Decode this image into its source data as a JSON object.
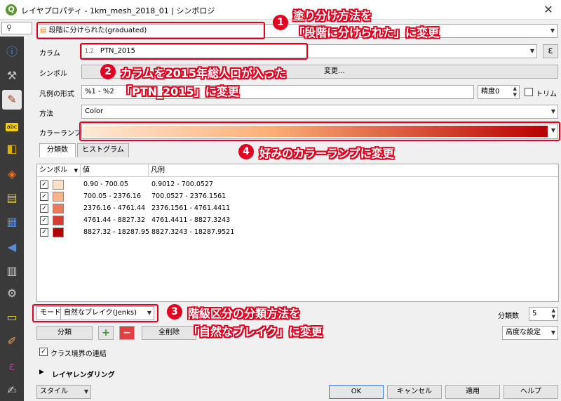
{
  "window": {
    "title": "レイヤプロパティ - 1km_mesh_2018_01 | シンボロジ",
    "close": "✕"
  },
  "renderer": {
    "value": "段階に分けられた(graduated)"
  },
  "column": {
    "label": "カラム",
    "type_tag": "1.2",
    "value": "PTN_2015",
    "expr_btn": "ε"
  },
  "symbol": {
    "label": "シンボル",
    "btn_text": "変更..."
  },
  "legend_format": {
    "label": "凡例の形式",
    "value": "%1 - %2",
    "precision_label": "精度",
    "precision_value": "0",
    "trim_label": "トリム"
  },
  "method": {
    "label": "方法",
    "value": "Color"
  },
  "color_ramp": {
    "label": "カラーランプ",
    "start": "#fde9d3",
    "mid": "#fbb078",
    "end": "#b80000"
  },
  "tabs": [
    {
      "label": "分類数"
    },
    {
      "label": "ヒストグラム"
    }
  ],
  "table": {
    "headers": {
      "symbol": "シンボル",
      "value": "値",
      "legend": "凡例"
    },
    "rows": [
      {
        "value": "0.90 - 700.05",
        "legend": "0.9012 - 700.0527",
        "color": "#fde0c5"
      },
      {
        "value": "700.05 - 2376.16",
        "legend": "700.0527 - 2376.1561",
        "color": "#fbb487"
      },
      {
        "value": "2376.16 - 4761.44",
        "legend": "2376.1561 - 4761.4411",
        "color": "#f0795a"
      },
      {
        "value": "4761.44 - 8827.32",
        "legend": "4761.4411 - 8827.3243",
        "color": "#d83a34"
      },
      {
        "value": "8827.32 - 18287.95",
        "legend": "8827.3243 - 18287.9521",
        "color": "#b30000"
      }
    ]
  },
  "mode": {
    "label": "モード",
    "value": "自然なブレイク(Jenks)"
  },
  "classes": {
    "label": "分類数",
    "value": "5"
  },
  "actions": {
    "classify": "分類",
    "add": "+",
    "remove": "−",
    "delete_all": "全削除",
    "advanced": "高度な設定"
  },
  "link_class_bounds": {
    "label": "クラス境界の連結"
  },
  "layer_rendering": {
    "label": "レイヤレンダリング"
  },
  "footer": {
    "style": "スタイル",
    "ok": "OK",
    "cancel": "キャンセル",
    "apply": "適用",
    "help": "ヘルプ"
  },
  "annotations": {
    "a1_num": "1",
    "a1_line1": "塗り分け方法を",
    "a1_line2": "「段階に分けられた」に変更",
    "a2_num": "2",
    "a2_line1": "カラムを2015年総人口が入った",
    "a2_line2": "「PTN_2015」に変更",
    "a3_num": "3",
    "a3_line1": "階級区分の分類方法を",
    "a3_line2": "「自然なブレイク」に変更",
    "a4_num": "4",
    "a4_line1": "好みのカラーランプに変更"
  },
  "colors": {
    "accent_red": "#e00020",
    "qgis_green": "#589632"
  }
}
